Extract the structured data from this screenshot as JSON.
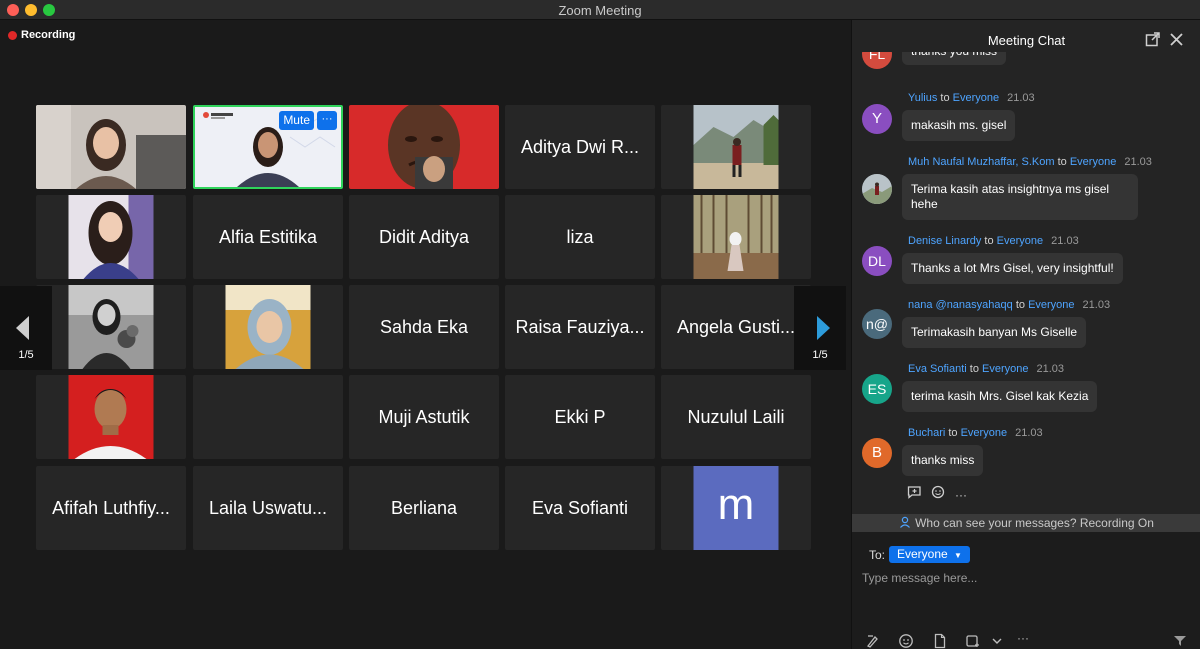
{
  "window": {
    "title": "Zoom Meeting"
  },
  "recording": {
    "label": "Recording"
  },
  "gallery": {
    "tiles": [
      {
        "type": "photo",
        "photo": "smiling-woman"
      },
      {
        "type": "photo",
        "photo": "speaker-woman-slide",
        "mute_label": "Mute",
        "more_label": "···"
      },
      {
        "type": "photo",
        "photo": "crying-man-meme"
      },
      {
        "type": "name",
        "name": "Aditya Dwi R..."
      },
      {
        "type": "photo",
        "photo": "person-mountain"
      },
      {
        "type": "photo",
        "photo": "woman-portrait"
      },
      {
        "type": "name",
        "name": "Alfia Estitika"
      },
      {
        "type": "name",
        "name": "Didit Aditya"
      },
      {
        "type": "name",
        "name": "liza"
      },
      {
        "type": "photo",
        "photo": "woman-forest"
      },
      {
        "type": "photo",
        "photo": "bw-woman-flowers"
      },
      {
        "type": "photo",
        "photo": "hijab-woman"
      },
      {
        "type": "name",
        "name": "Sahda Eka"
      },
      {
        "type": "name",
        "name": "Raisa Fauziya..."
      },
      {
        "type": "name",
        "name": "Angela Gusti..."
      },
      {
        "type": "photo",
        "photo": "boy-red-background"
      },
      {
        "type": "empty"
      },
      {
        "type": "name",
        "name": "Muji Astutik"
      },
      {
        "type": "name",
        "name": "Ekki P"
      },
      {
        "type": "name",
        "name": "Nuzulul Laili"
      },
      {
        "type": "name",
        "name": "Afifah Luthfiy..."
      },
      {
        "type": "name",
        "name": "Laila Uswatu..."
      },
      {
        "type": "name",
        "name": "Berliana"
      },
      {
        "type": "name",
        "name": "Eva Sofianti"
      },
      {
        "type": "letter",
        "letter": "m",
        "color": "#5b6bbf"
      }
    ],
    "page_left": "1/5",
    "page_right": "1/5"
  },
  "chat": {
    "title": "Meeting Chat",
    "messages": [
      {
        "avatar": "FL",
        "avatar_color": "#d44b3e",
        "sender": "",
        "to_label": "",
        "recipient": "",
        "time": "",
        "text": "thanks you miss"
      },
      {
        "avatar": "Y",
        "avatar_color": "#8a4ec0",
        "sender": "Yulius",
        "to_label": "to",
        "recipient": "Everyone",
        "time": "21.03",
        "text": "makasih ms. gisel"
      },
      {
        "avatar": "",
        "avatar_color": "#7a8a94",
        "sender": "Muh Naufal Muzhaffar, S.Kom",
        "to_label": "to",
        "recipient": "Everyone",
        "time": "21.03",
        "text": "Terima kasih atas insightnya ms gisel hehe"
      },
      {
        "avatar": "DL",
        "avatar_color": "#8a4ec0",
        "sender": "Denise Linardy",
        "to_label": "to",
        "recipient": "Everyone",
        "time": "21.03",
        "text": "Thanks a lot Mrs Gisel, very insightful!"
      },
      {
        "avatar": "n@",
        "avatar_color": "#4a6a7c",
        "sender": "nana @nanasyahaqq",
        "to_label": "to",
        "recipient": "Everyone",
        "time": "21.03",
        "text": "Terimakasih banyan Ms Giselle"
      },
      {
        "avatar": "ES",
        "avatar_color": "#17a58a",
        "sender": "Eva Sofianti",
        "to_label": "to",
        "recipient": "Everyone",
        "time": "21.03",
        "text": "terima kasih Mrs. Gisel kak Kezia"
      },
      {
        "avatar": "B",
        "avatar_color": "#e0692a",
        "sender": "Buchari",
        "to_label": "to",
        "recipient": "Everyone",
        "time": "21.03",
        "text": "thanks miss"
      }
    ],
    "more_label": "···",
    "notice": "Who can see your messages? Recording On",
    "to_label": "To:",
    "recipient_select": "Everyone",
    "input_placeholder": "Type message here...",
    "toolbar_more": "···"
  }
}
